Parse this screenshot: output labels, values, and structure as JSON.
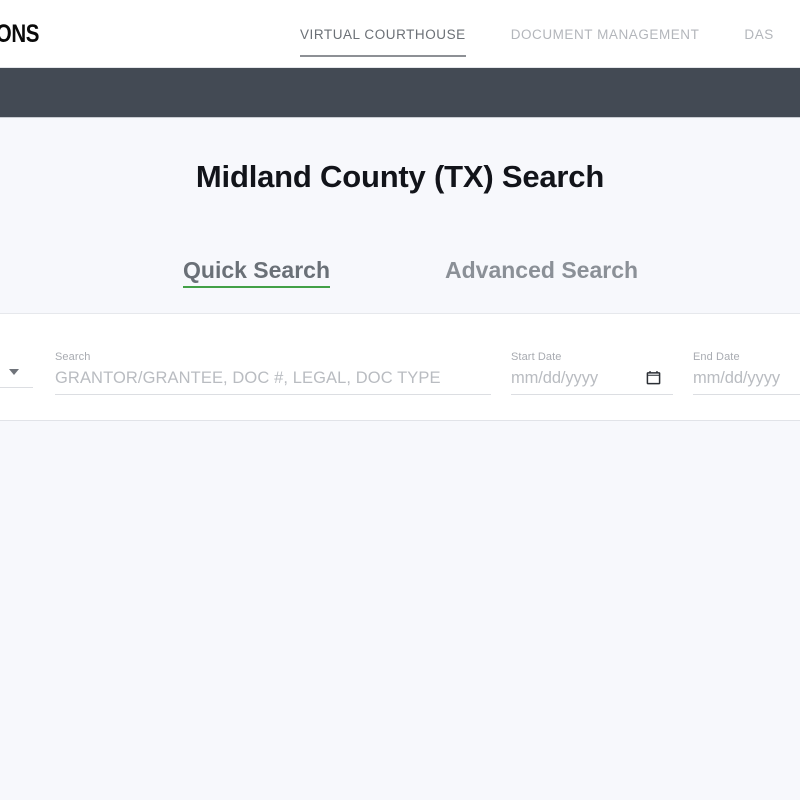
{
  "header": {
    "logo_text": "UTIONS",
    "nav": [
      {
        "label": "VIRTUAL COURTHOUSE",
        "active": true
      },
      {
        "label": "DOCUMENT MANAGEMENT",
        "active": false
      },
      {
        "label": "DAS",
        "active": false
      }
    ]
  },
  "page": {
    "title": "Midland County (TX) Search"
  },
  "mode_tabs": {
    "quick": "Quick Search",
    "advanced": "Advanced Search",
    "active_color": "#43a047"
  },
  "search_form": {
    "type_select": {
      "label": "",
      "value": ""
    },
    "search": {
      "label": "Search",
      "value": "",
      "placeholder": "GRANTOR/GRANTEE, DOC #, LEGAL, DOC TYPE"
    },
    "start_date": {
      "label": "Start Date",
      "value": "",
      "placeholder": "mm/dd/yyyy"
    },
    "end_date": {
      "label": "End Date",
      "value": "",
      "placeholder": "mm/dd/yyyy"
    }
  },
  "colors": {
    "dark_band": "#434a54",
    "page_background": "#f7f8fc",
    "accent_green": "#43a047",
    "nav_underline": "#8d9095"
  }
}
